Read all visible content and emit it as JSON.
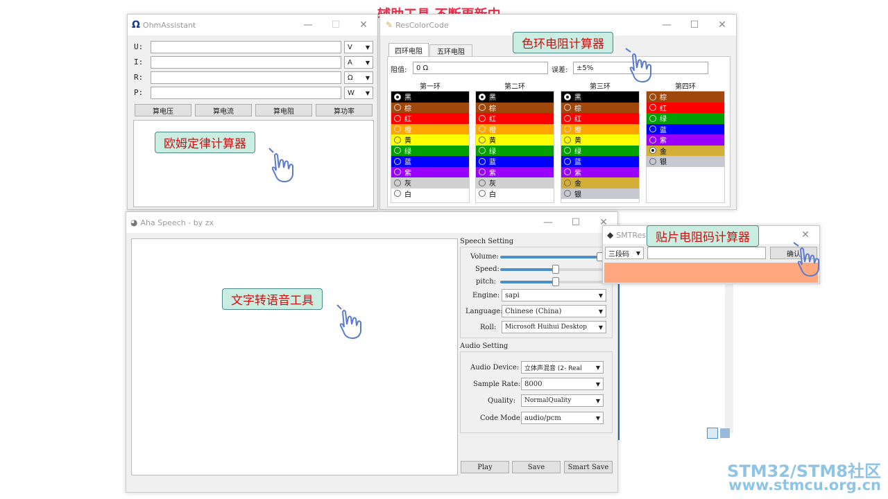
{
  "headline": "辅助工具 不断更新中",
  "watermark": {
    "line1": "STM32/STM8社区",
    "line2": "www.stmcu.org.cn"
  },
  "callouts": {
    "ohm": "欧姆定律计算器",
    "rescolor": "色环电阻计算器",
    "smt": "贴片电阻码计算器",
    "speech": "文字转语音工具"
  },
  "ohm_window": {
    "title": "OhmAssistant",
    "rows": [
      {
        "label": "U:",
        "unit": "V"
      },
      {
        "label": "I:",
        "unit": "A"
      },
      {
        "label": "R:",
        "unit": "Ω"
      },
      {
        "label": "P:",
        "unit": "W"
      }
    ],
    "buttons": [
      "算电压",
      "算电流",
      "算电阻",
      "算功率"
    ]
  },
  "rescolor_window": {
    "title": "ResColorCode",
    "tabs": [
      "四环电阻",
      "五环电阻"
    ],
    "resistance_label": "阻值:",
    "resistance_value": "0 Ω",
    "tolerance_label": "误差:",
    "tolerance_value": "±5%",
    "ring_headers": [
      "第一环",
      "第二环",
      "第三环",
      "第四环"
    ],
    "ring1": [
      {
        "name": "黑",
        "color": "#000000",
        "text": "#ffffff",
        "selected": true
      },
      {
        "name": "棕",
        "color": "#a0480c",
        "text": "#ffffff"
      },
      {
        "name": "红",
        "color": "#ff0000",
        "text": "#ffffff"
      },
      {
        "name": "橙",
        "color": "#ffa500",
        "text": "#ffffff"
      },
      {
        "name": "黄",
        "color": "#ffff00",
        "text": "#000000"
      },
      {
        "name": "绿",
        "color": "#00a000",
        "text": "#ffffff"
      },
      {
        "name": "蓝",
        "color": "#0000ff",
        "text": "#ffffff"
      },
      {
        "name": "紫",
        "color": "#9900ff",
        "text": "#ffffff"
      },
      {
        "name": "灰",
        "color": "#d0d0d0",
        "text": "#000000"
      },
      {
        "name": "白",
        "color": "#ffffff",
        "text": "#000000"
      }
    ],
    "ring2": [
      {
        "name": "黑",
        "color": "#000000",
        "text": "#ffffff",
        "selected": true
      },
      {
        "name": "棕",
        "color": "#a0480c",
        "text": "#ffffff"
      },
      {
        "name": "红",
        "color": "#ff0000",
        "text": "#ffffff"
      },
      {
        "name": "橙",
        "color": "#ffa500",
        "text": "#ffffff"
      },
      {
        "name": "黄",
        "color": "#ffff00",
        "text": "#000000"
      },
      {
        "name": "绿",
        "color": "#00a000",
        "text": "#ffffff"
      },
      {
        "name": "蓝",
        "color": "#0000ff",
        "text": "#ffffff"
      },
      {
        "name": "紫",
        "color": "#9900ff",
        "text": "#ffffff"
      },
      {
        "name": "灰",
        "color": "#d0d0d0",
        "text": "#000000"
      },
      {
        "name": "白",
        "color": "#ffffff",
        "text": "#000000"
      }
    ],
    "ring3": [
      {
        "name": "黑",
        "color": "#000000",
        "text": "#ffffff",
        "selected": true
      },
      {
        "name": "棕",
        "color": "#a0480c",
        "text": "#ffffff"
      },
      {
        "name": "红",
        "color": "#ff0000",
        "text": "#ffffff"
      },
      {
        "name": "橙",
        "color": "#ffa500",
        "text": "#ffffff"
      },
      {
        "name": "黄",
        "color": "#ffff00",
        "text": "#000000"
      },
      {
        "name": "绿",
        "color": "#00a000",
        "text": "#ffffff"
      },
      {
        "name": "蓝",
        "color": "#0000ff",
        "text": "#ffffff"
      },
      {
        "name": "紫",
        "color": "#9900ff",
        "text": "#ffffff"
      },
      {
        "name": "金",
        "color": "#d4af37",
        "text": "#000000"
      },
      {
        "name": "银",
        "color": "#c8c8d0",
        "text": "#000000"
      }
    ],
    "ring4": [
      {
        "name": "棕",
        "color": "#a0480c",
        "text": "#ffffff"
      },
      {
        "name": "红",
        "color": "#ff0000",
        "text": "#ffffff"
      },
      {
        "name": "绿",
        "color": "#00a000",
        "text": "#ffffff"
      },
      {
        "name": "蓝",
        "color": "#0000ff",
        "text": "#ffffff"
      },
      {
        "name": "紫",
        "color": "#9900ff",
        "text": "#ffffff"
      },
      {
        "name": "金",
        "color": "#d4af37",
        "text": "#000000",
        "selected": true
      },
      {
        "name": "银",
        "color": "#c8c8d0",
        "text": "#000000"
      }
    ]
  },
  "speech_window": {
    "title": "Aha Speech - by zx",
    "speech_setting": "Speech Setting",
    "volume_label": "Volume:",
    "speed_label": "Speed:",
    "pitch_label": "pitch:",
    "volume": 0.9,
    "speed": 0.5,
    "pitch": 0.5,
    "engine_label": "Engine:",
    "engine": "sapi",
    "language_label": "Language:",
    "language": "Chinese (China)",
    "roll_label": "Roll:",
    "roll": "Microsoft Huihui Desktop",
    "audio_setting": "Audio Setting",
    "device_label": "Audio Device:",
    "device": "立体声混音 (2- Real",
    "rate_label": "Sample Rate:",
    "rate": "8000",
    "quality_label": "Quality:",
    "quality": "NormalQuality",
    "mode_label": "Code Mode:",
    "mode": "audio/pcm",
    "play": "Play",
    "save": "Save",
    "smart_save": "Smart Save"
  },
  "smt_window": {
    "title": "SMTRes",
    "mode": "三段码",
    "confirm": "确认",
    "result_color": "#ffa880"
  }
}
